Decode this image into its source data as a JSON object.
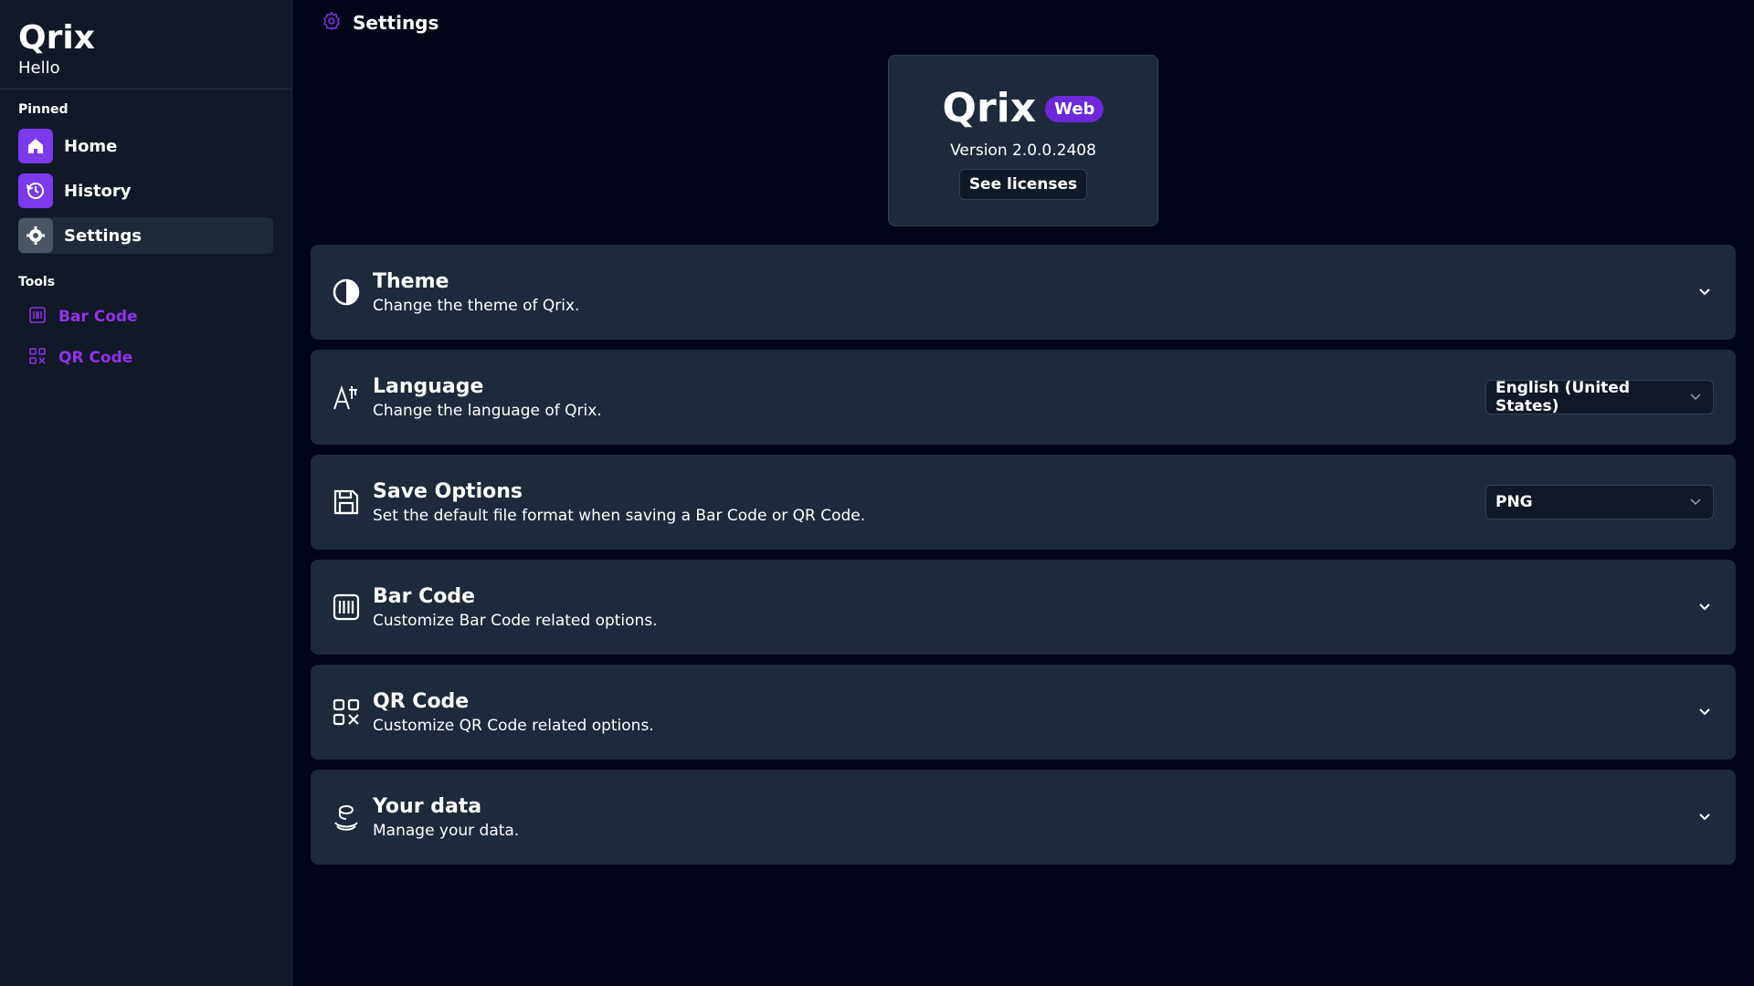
{
  "sidebar": {
    "app_title": "Qrix",
    "greeting": "Hello",
    "pinned_label": "Pinned",
    "pinned_items": [
      {
        "label": "Home",
        "icon": "home-icon"
      },
      {
        "label": "History",
        "icon": "history-icon"
      },
      {
        "label": "Settings",
        "icon": "gear-icon"
      }
    ],
    "tools_label": "Tools",
    "tool_items": [
      {
        "label": "Bar Code",
        "icon": "barcode-icon"
      },
      {
        "label": "QR Code",
        "icon": "qrcode-icon"
      }
    ]
  },
  "header": {
    "title": "Settings",
    "icon": "gear-icon"
  },
  "about": {
    "name": "Qrix",
    "badge": "Web",
    "version": "Version 2.0.0.2408",
    "licenses_button": "See licenses"
  },
  "settings": [
    {
      "title": "Theme",
      "description": "Change the theme of Qrix.",
      "icon": "theme-icon"
    },
    {
      "title": "Language",
      "description": "Change the language of Qrix.",
      "icon": "language-icon",
      "selected": "English (United States)"
    },
    {
      "title": "Save Options",
      "description": "Set the default file format when saving a Bar Code or QR Code.",
      "icon": "save-icon",
      "selected": "PNG"
    },
    {
      "title": "Bar Code",
      "description": "Customize Bar Code related options.",
      "icon": "barcode-icon"
    },
    {
      "title": "QR Code",
      "description": "Customize QR Code related options.",
      "icon": "qrcode-icon"
    },
    {
      "title": "Your data",
      "description": "Manage your data.",
      "icon": "data-icon"
    }
  ],
  "colors": {
    "accent": "#7c3aed",
    "tool_text": "#9333ea",
    "panel_bg": "#1e293b",
    "page_bg": "#020417",
    "sidebar_bg": "#111827"
  }
}
